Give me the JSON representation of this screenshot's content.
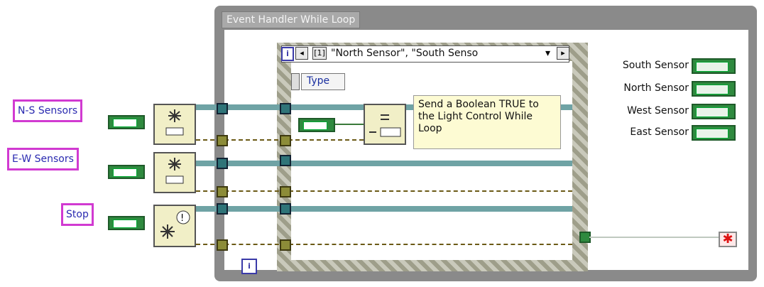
{
  "loop": {
    "title": "Event Handler While Loop",
    "iteration_label": "i",
    "stop_glyph": "✱"
  },
  "event_structure": {
    "selector_index": "[1]",
    "selector_text": "\"North Sensor\", \"South Senso",
    "selector_arrow": "▾",
    "left_button": "◂",
    "right_button": "▸",
    "event_data_node": "Type",
    "node_i_label": "i",
    "comment": "Send a Boolean TRUE to the Light Control While Loop"
  },
  "controls": [
    {
      "label": "N-S Sensors"
    },
    {
      "label": "E-W Sensors"
    },
    {
      "label": "Stop"
    }
  ],
  "indicators": [
    {
      "label": "South Sensor"
    },
    {
      "label": "North Sensor"
    },
    {
      "label": "West Sensor"
    },
    {
      "label": "East Sensor"
    }
  ],
  "colors": {
    "boolean_green": "#2f8a3f",
    "control_border": "#d13ad1",
    "wire_teal": "#6fa3a5",
    "wire_brown": "#6b5a16",
    "loop_gray": "#8a8a8a"
  }
}
